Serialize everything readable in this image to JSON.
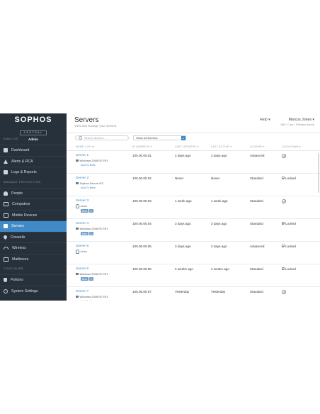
{
  "brand": {
    "logo": "SOPHOS",
    "product": "CENTRAL",
    "role": "Admin"
  },
  "sidebar": {
    "sections": [
      {
        "title": "ANALYZE",
        "items": [
          {
            "label": "Dashboard",
            "icon": "dashboard-icon"
          },
          {
            "label": "Alerts & RCA",
            "icon": "alert-icon"
          },
          {
            "label": "Logs & Reports",
            "icon": "logs-icon"
          }
        ]
      },
      {
        "title": "MANAGE PROTECTION",
        "items": [
          {
            "label": "People",
            "icon": "people-icon"
          },
          {
            "label": "Computers",
            "icon": "computer-icon"
          },
          {
            "label": "Mobile Devices",
            "icon": "mobile-icon"
          },
          {
            "label": "Servers",
            "icon": "server-icon",
            "active": true
          },
          {
            "label": "Firewalls",
            "icon": "firewall-icon"
          },
          {
            "label": "Wireless",
            "icon": "wireless-icon"
          },
          {
            "label": "Mailboxes",
            "icon": "mailbox-icon"
          }
        ]
      },
      {
        "title": "CONFIGURE",
        "items": [
          {
            "label": "Policies",
            "icon": "shield-icon"
          },
          {
            "label": "System Settings",
            "icon": "gear-icon"
          }
        ]
      }
    ]
  },
  "header": {
    "title": "Servers",
    "subtitle": "View and manage your servers.",
    "help": "Help ▾",
    "user_name": "Marcus Jones ▾",
    "user_role": "ABC Corp • Primary Admin"
  },
  "toolbar": {
    "search_placeholder": "Search devices...",
    "filter_value": "Show All Devices"
  },
  "table": {
    "columns": [
      "NAME | OS ▼",
      "IP ADDRESS ▾",
      "LAST UPDATED ▾",
      "LAST ACTIVE ▾",
      "LICENSE ▾",
      "LOCKDOWN ▾"
    ],
    "rows": [
      {
        "name": "Server 1",
        "os": "Windows 2008 R2 SP1",
        "os_type": "windows",
        "extra": "Add To Beta",
        "ip": "100.00.00.01",
        "updated": "2 days ago",
        "active": "3 days ago",
        "license": "Advanced",
        "lockdown": ""
      },
      {
        "name": "Server 2",
        "os": "Sophos Secure OS",
        "os_type": "windows",
        "extra": "Add To Beta",
        "ip": "100.00.00.02",
        "updated": "Never",
        "active": "Never",
        "license": "Standard",
        "lockdown": "Locked"
      },
      {
        "name": "Server 3",
        "os": "Linux",
        "os_type": "linux",
        "extra": "Beta",
        "ip": "100.00.00.03",
        "updated": "1 week ago",
        "active": "1 week ago",
        "license": "Standard",
        "lockdown": ""
      },
      {
        "name": "Server 4",
        "os": "Windows 2008 R2 SP1",
        "os_type": "windows",
        "extra": "Beta",
        "ip": "100.00.00.04",
        "updated": "3 days ago",
        "active": "3 days ago",
        "license": "Standard",
        "lockdown": "Locked"
      },
      {
        "name": "Server 5",
        "os": "Linux",
        "os_type": "linux",
        "extra": "",
        "ip": "100.00.00.05",
        "updated": "3 days ago",
        "active": "3 days ago",
        "license": "Advanced",
        "lockdown": "Locked"
      },
      {
        "name": "Server 6",
        "os": "Windows 2008 R2 SP1",
        "os_type": "windows",
        "extra": "Beta",
        "ip": "100.00.00.06",
        "updated": "2 weeks ago",
        "active": "2 weeks ago",
        "license": "Standard",
        "lockdown": "Locked"
      },
      {
        "name": "Server 7",
        "os": "Windows 2008 R2 SP1",
        "os_type": "windows",
        "extra": "Add To Beta",
        "ip": "100.00.00.07",
        "updated": "Yesterday",
        "active": "Yesterday",
        "license": "Standard",
        "lockdown": ""
      }
    ]
  },
  "colors": {
    "sidebar": "#27313b",
    "accent": "#3f8ac7"
  }
}
